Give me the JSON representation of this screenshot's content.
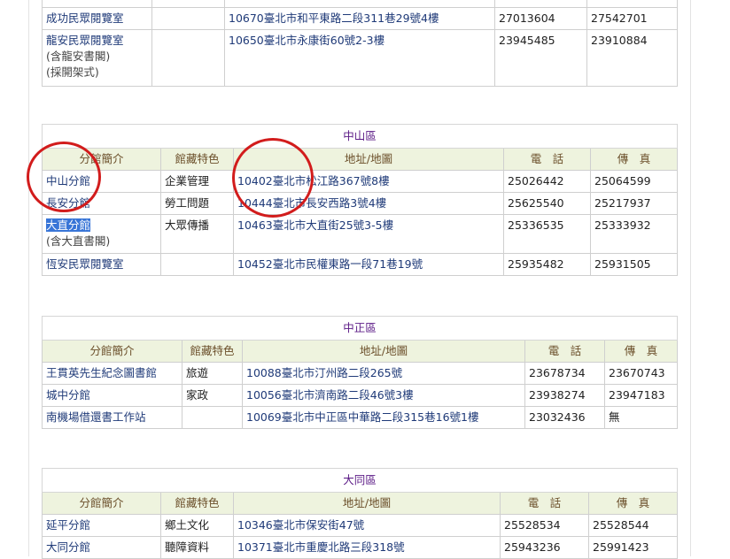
{
  "columns": {
    "branch": "分館簡介",
    "feature": "館藏特色",
    "address": "地址/地圖",
    "phone": "電　話",
    "fax": "傳　真"
  },
  "top_section": {
    "rows": [
      {
        "name": "",
        "sub": [],
        "feature": "",
        "address": "",
        "phone": "",
        "fax": ""
      },
      {
        "name": "成功民眾閱覽室",
        "sub": [],
        "feature": "",
        "address": "10670臺北市和平東路二段311巷29號4樓",
        "phone": "27013604",
        "fax": "27542701"
      },
      {
        "name": "龍安民眾閱覽室",
        "sub": [
          "(含龍安書閣)",
          "(採開架式)"
        ],
        "feature": "",
        "address": "10650臺北市永康街60號2-3樓",
        "phone": "23945485",
        "fax": "23910884"
      }
    ]
  },
  "sections": [
    {
      "title": "中山區",
      "rows": [
        {
          "name": "中山分館",
          "sub": [],
          "feature": "企業管理",
          "address": "10402臺北市松江路367號8樓",
          "phone": "25026442",
          "fax": "25064599"
        },
        {
          "name": "長安分館",
          "sub": [],
          "feature": "勞工問題",
          "address": "10444臺北市長安西路3號4樓",
          "phone": "25625540",
          "fax": "25217937"
        },
        {
          "name": "大直分館",
          "sub": [
            "(含大直書閣)"
          ],
          "feature": "大眾傳播",
          "address": "10463臺北市大直街25號3-5樓",
          "phone": "25336535",
          "fax": "25333932"
        },
        {
          "name": "恆安民眾閱覽室",
          "sub": [],
          "feature": "",
          "address": "10452臺北市民權東路一段71巷19號",
          "phone": "25935482",
          "fax": "25931505"
        }
      ]
    },
    {
      "title": "中正區",
      "rows": [
        {
          "name": "王貫英先生紀念圖書館",
          "sub": [],
          "feature": "旅遊",
          "address": "10088臺北市汀州路二段265號",
          "phone": "23678734",
          "fax": "23670743"
        },
        {
          "name": "城中分館",
          "sub": [],
          "feature": "家政",
          "address": "10056臺北市濟南路二段46號3樓",
          "phone": "23938274",
          "fax": "23947183"
        },
        {
          "name": "南機場借還書工作站",
          "sub": [],
          "feature": "",
          "address": "10069臺北市中正區中華路二段315巷16號1樓",
          "phone": "23032436",
          "fax": "無"
        }
      ]
    },
    {
      "title": "大同區",
      "rows": [
        {
          "name": "延平分館",
          "sub": [],
          "feature": "鄉土文化",
          "address": "10346臺北市保安街47號",
          "phone": "25528534",
          "fax": "25528544"
        },
        {
          "name": "大同分館",
          "sub": [],
          "feature": "聽障資料",
          "address": "10371臺北市重慶北路三段318號",
          "phone": "25943236",
          "fax": "25991423"
        }
      ]
    }
  ]
}
